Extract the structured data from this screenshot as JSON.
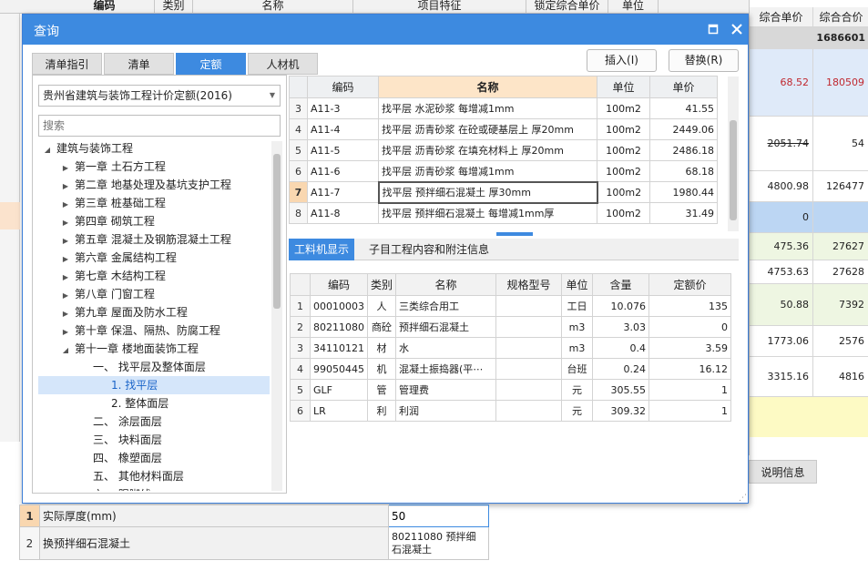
{
  "background": {
    "headers": [
      "编码",
      "类别",
      "名称",
      "项目特征",
      "锁定综合单价",
      "单位"
    ],
    "right_headers": [
      "综合单价",
      "综合合价"
    ],
    "total": "1686601",
    "rows": [
      {
        "price": "68.52",
        "total": "180509",
        "red": true
      },
      {
        "price": "2051.74",
        "total": "54",
        "strike": true
      },
      {
        "price": "4800.98",
        "total": "126477"
      },
      {
        "price": "0",
        "total": ""
      },
      {
        "price": "475.36",
        "total": "27627"
      },
      {
        "price": "4753.63",
        "total": "27628"
      },
      {
        "price": "50.88",
        "total": "7392"
      },
      {
        "price": "1773.06",
        "total": "2576"
      },
      {
        "price": "3315.16",
        "total": "4816"
      }
    ],
    "tab_label": "说明信息"
  },
  "dialog": {
    "title": "查询",
    "tabs": [
      "清单指引",
      "清单",
      "定额",
      "人材机"
    ],
    "insert_button": "插入(I)",
    "replace_button": "替换(R)",
    "quota_select": "贵州省建筑与装饰工程计价定额(2016)",
    "search_placeholder": "搜索",
    "tree": [
      {
        "label": "建筑与装饰工程",
        "level": 0,
        "open": true
      },
      {
        "label": "第一章 土石方工程",
        "level": 1
      },
      {
        "label": "第二章 地基处理及基坑支护工程",
        "level": 1
      },
      {
        "label": "第三章 桩基础工程",
        "level": 1
      },
      {
        "label": "第四章 砌筑工程",
        "level": 1
      },
      {
        "label": "第五章 混凝土及钢筋混凝土工程",
        "level": 1
      },
      {
        "label": "第六章 金属结构工程",
        "level": 1
      },
      {
        "label": "第七章 木结构工程",
        "level": 1
      },
      {
        "label": "第八章 门窗工程",
        "level": 1
      },
      {
        "label": "第九章 屋面及防水工程",
        "level": 1
      },
      {
        "label": "第十章 保温、隔热、防腐工程",
        "level": 1
      },
      {
        "label": "第十一章 楼地面装饰工程",
        "level": 1,
        "open": true
      },
      {
        "label": "一、 找平层及整体面层",
        "level": 2,
        "open": true
      },
      {
        "label": "1. 找平层",
        "level": 3,
        "selected": true
      },
      {
        "label": "2. 整体面层",
        "level": 3
      },
      {
        "label": "二、 涂层面层",
        "level": 2
      },
      {
        "label": "三、 块料面层",
        "level": 2
      },
      {
        "label": "四、 橡塑面层",
        "level": 2
      },
      {
        "label": "五、 其他材料面层",
        "level": 2
      },
      {
        "label": "六、 踢脚线",
        "level": 2
      }
    ],
    "upper_headers": [
      "编码",
      "名称",
      "单位",
      "单价"
    ],
    "upper_rows": [
      {
        "n": "3",
        "code": "A11-3",
        "name": "找平层 水泥砂浆 每增减1mm",
        "unit": "100m2",
        "price": "41.55"
      },
      {
        "n": "4",
        "code": "A11-4",
        "name": "找平层 沥青砂浆 在砼或硬基层上 厚20mm",
        "unit": "100m2",
        "price": "2449.06"
      },
      {
        "n": "5",
        "code": "A11-5",
        "name": "找平层 沥青砂浆 在填充材料上 厚20mm",
        "unit": "100m2",
        "price": "2486.18"
      },
      {
        "n": "6",
        "code": "A11-6",
        "name": "找平层 沥青砂浆 每增减1mm",
        "unit": "100m2",
        "price": "68.18"
      },
      {
        "n": "7",
        "code": "A11-7",
        "name": "找平层 预拌细石混凝土 厚30mm",
        "unit": "100m2",
        "price": "1980.44",
        "current": true
      },
      {
        "n": "8",
        "code": "A11-8",
        "name": "找平层 预拌细石混凝土 每增减1mm厚",
        "unit": "100m2",
        "price": "31.49"
      }
    ],
    "subtabs": [
      "工料机显示",
      "子目工程内容和附注信息"
    ],
    "lower_headers": [
      "编码",
      "类别",
      "名称",
      "规格型号",
      "单位",
      "含量",
      "定额价"
    ],
    "lower_rows": [
      {
        "n": "1",
        "code": "00010003",
        "type": "人",
        "name": "三类综合用工",
        "spec": "",
        "unit": "工日",
        "qty": "10.076",
        "price": "135"
      },
      {
        "n": "2",
        "code": "80211080",
        "type": "商砼",
        "name": "预拌细石混凝土",
        "spec": "",
        "unit": "m3",
        "qty": "3.03",
        "price": "0"
      },
      {
        "n": "3",
        "code": "34110121",
        "type": "材",
        "name": "水",
        "spec": "",
        "unit": "m3",
        "qty": "0.4",
        "price": "3.59"
      },
      {
        "n": "4",
        "code": "99050445",
        "type": "机",
        "name": "混凝土振捣器(平⋯",
        "spec": "",
        "unit": "台班",
        "qty": "0.24",
        "price": "16.12"
      },
      {
        "n": "5",
        "code": "GLF",
        "type": "管",
        "name": "管理费",
        "spec": "",
        "unit": "元",
        "qty": "305.55",
        "price": "1"
      },
      {
        "n": "6",
        "code": "LR",
        "type": "利",
        "name": "利润",
        "spec": "",
        "unit": "元",
        "qty": "309.32",
        "price": "1"
      }
    ]
  },
  "params": [
    {
      "n": "1",
      "name": "实际厚度(mm)",
      "value": "50"
    },
    {
      "n": "2",
      "name": "换预拌细石混凝土",
      "value": "80211080  预拌细石混凝土"
    }
  ]
}
